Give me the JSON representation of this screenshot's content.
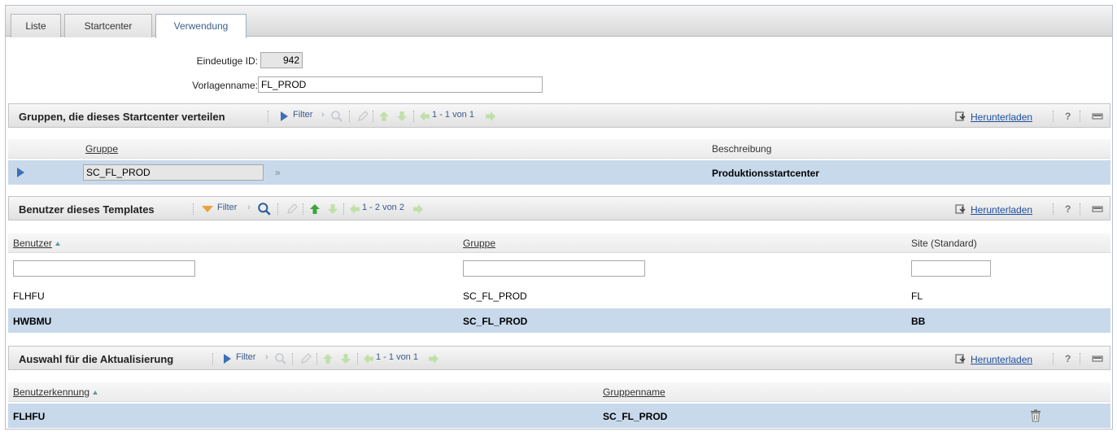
{
  "tabs": [
    {
      "label": "Liste"
    },
    {
      "label": "Startcenter"
    },
    {
      "label": "Verwendung"
    }
  ],
  "form": {
    "id_label": "Eindeutige ID:",
    "id_value": "942",
    "template_label": "Vorlagenname:",
    "template_value": "FL_PROD"
  },
  "toolbar": {
    "filter": "Filter",
    "download": "Herunterladen",
    "help": "?"
  },
  "section1": {
    "title": "Gruppen, die dieses Startcenter verteilen",
    "paging": "1 - 1 von 1",
    "columns": [
      "Gruppe",
      "Beschreibung"
    ],
    "rows": [
      {
        "group": "SC_FL_PROD",
        "lookup": "»",
        "description": "Produktionsstartcenter"
      }
    ]
  },
  "section2": {
    "title": "Benutzer dieses Templates",
    "paging": "1 - 2 von 2",
    "columns": [
      "Benutzer",
      "Gruppe",
      "Site (Standard)"
    ],
    "rows": [
      {
        "user": "FLHFU",
        "group": "SC_FL_PROD",
        "site": "FL"
      },
      {
        "user": "HWBMU",
        "group": "SC_FL_PROD",
        "site": "BB"
      }
    ]
  },
  "section3": {
    "title": "Auswahl für die Aktualisierung",
    "paging": "1 - 1 von 1",
    "columns": [
      "Benutzerkennung",
      "Gruppenname"
    ],
    "rows": [
      {
        "userid": "FLHFU",
        "groupname": "SC_FL_PROD"
      }
    ]
  },
  "colors": {
    "accent": "#3a5f8a",
    "selected_row": "#c8d9ec",
    "link": "#1d4fa0"
  },
  "icons": [
    "play-icon",
    "filter-icon",
    "search-icon",
    "edit-icon",
    "arrow-up-icon",
    "arrow-down-icon",
    "prev-page-icon",
    "next-page-icon",
    "download-icon",
    "help-icon",
    "collapse-icon",
    "trash-icon",
    "sort-asc-icon",
    "row-arrow-icon"
  ]
}
